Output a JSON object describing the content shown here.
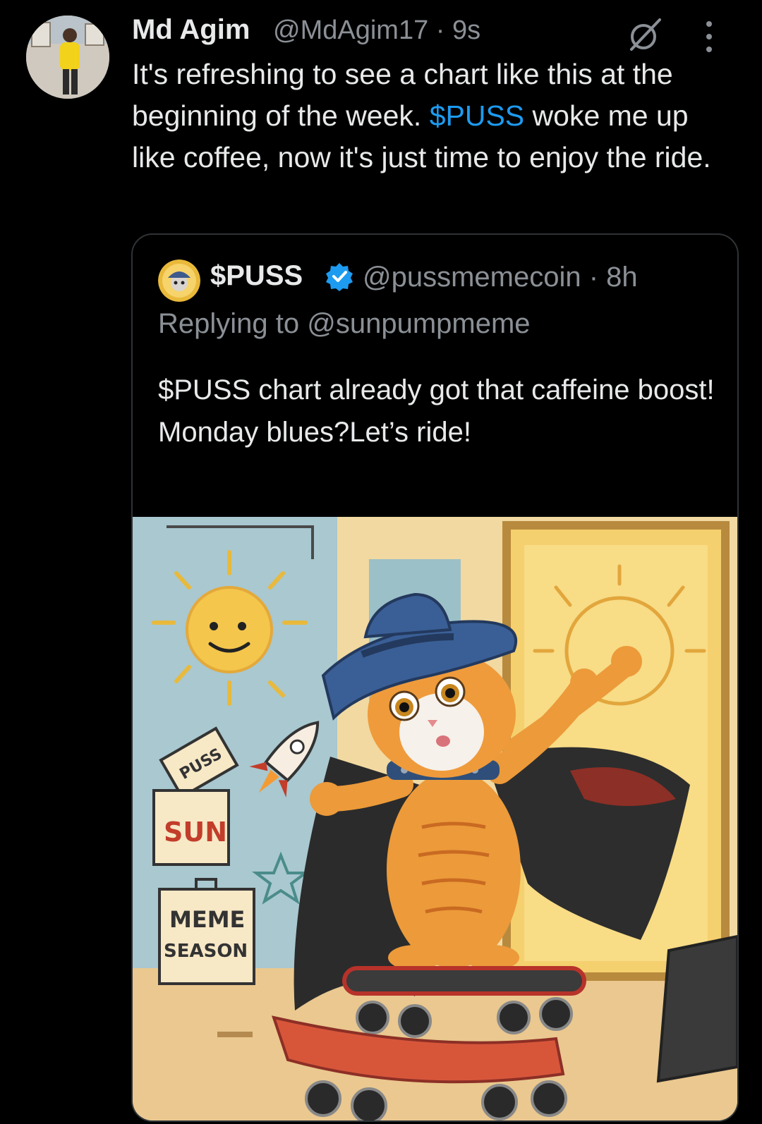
{
  "tweet": {
    "author_name": "Md Agim",
    "author_handle": "@MdAgim17",
    "time": "9s",
    "text_before": "It's refreshing to see a chart like this at the beginning of the week. ",
    "cashtag": "$PUSS",
    "text_after": " woke me up like coffee, now it's just time to enjoy the ride."
  },
  "quote": {
    "author_name": "$PUSS",
    "author_handle": "@pussmemecoin",
    "time": "8h",
    "reply_prefix": "Replying to",
    "reply_to": "@sunpumpmeme",
    "text": "$PUSS chart already got that caffeine boost!\nMonday blues?Let’s ride!"
  },
  "image": {
    "signs": {
      "puss": "PUSS",
      "sun": "SUN",
      "meme": "MEME",
      "season": "SEASON"
    }
  },
  "icons": [
    "grok-icon",
    "more-icon",
    "verified-icon"
  ],
  "colors": {
    "link": "#1d9bf0",
    "muted": "#8b9096",
    "background": "#000000",
    "verified": "#1d9bf0"
  }
}
